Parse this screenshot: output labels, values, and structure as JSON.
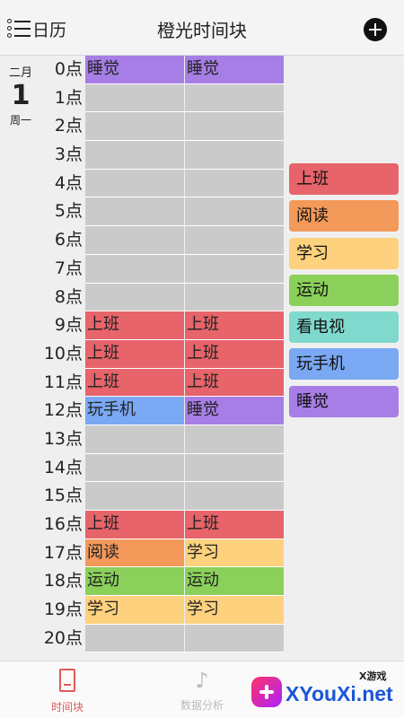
{
  "header": {
    "calendar_label": "日历",
    "title": "橙光时间块"
  },
  "date": {
    "month": "二月",
    "day": "1",
    "weekday": "周一"
  },
  "colors": {
    "empty": "#cacaca",
    "上班": "#e7646a",
    "阅读": "#f3995a",
    "学习": "#fdd17d",
    "运动": "#8bd05a",
    "看电视": "#7fd9cd",
    "玩手机": "#7aa8f2",
    "睡觉": "#a77ee6"
  },
  "hours": [
    "0点",
    "1点",
    "2点",
    "3点",
    "4点",
    "5点",
    "6点",
    "7点",
    "8点",
    "9点",
    "10点",
    "11点",
    "12点",
    "13点",
    "14点",
    "15点",
    "16点",
    "17点",
    "18点",
    "19点",
    "20点"
  ],
  "schedule": [
    [
      "睡觉",
      "睡觉"
    ],
    [
      "",
      ""
    ],
    [
      "",
      ""
    ],
    [
      "",
      ""
    ],
    [
      "",
      ""
    ],
    [
      "",
      ""
    ],
    [
      "",
      ""
    ],
    [
      "",
      ""
    ],
    [
      "",
      ""
    ],
    [
      "上班",
      "上班"
    ],
    [
      "上班",
      "上班"
    ],
    [
      "上班",
      "上班"
    ],
    [
      "玩手机",
      "睡觉"
    ],
    [
      "",
      ""
    ],
    [
      "",
      ""
    ],
    [
      "",
      ""
    ],
    [
      "上班",
      "上班"
    ],
    [
      "阅读",
      "学习"
    ],
    [
      "运动",
      "运动"
    ],
    [
      "学习",
      "学习"
    ],
    [
      "",
      ""
    ]
  ],
  "categories": [
    "上班",
    "阅读",
    "学习",
    "运动",
    "看电视",
    "玩手机",
    "睡觉"
  ],
  "tabs": [
    {
      "label": "时间块",
      "active": true,
      "icon": "bookmark-icon"
    },
    {
      "label": "数据分析",
      "active": false,
      "icon": "music-note-icon"
    }
  ],
  "watermark": {
    "small": "X游戏",
    "text": "XYouXi.net"
  }
}
